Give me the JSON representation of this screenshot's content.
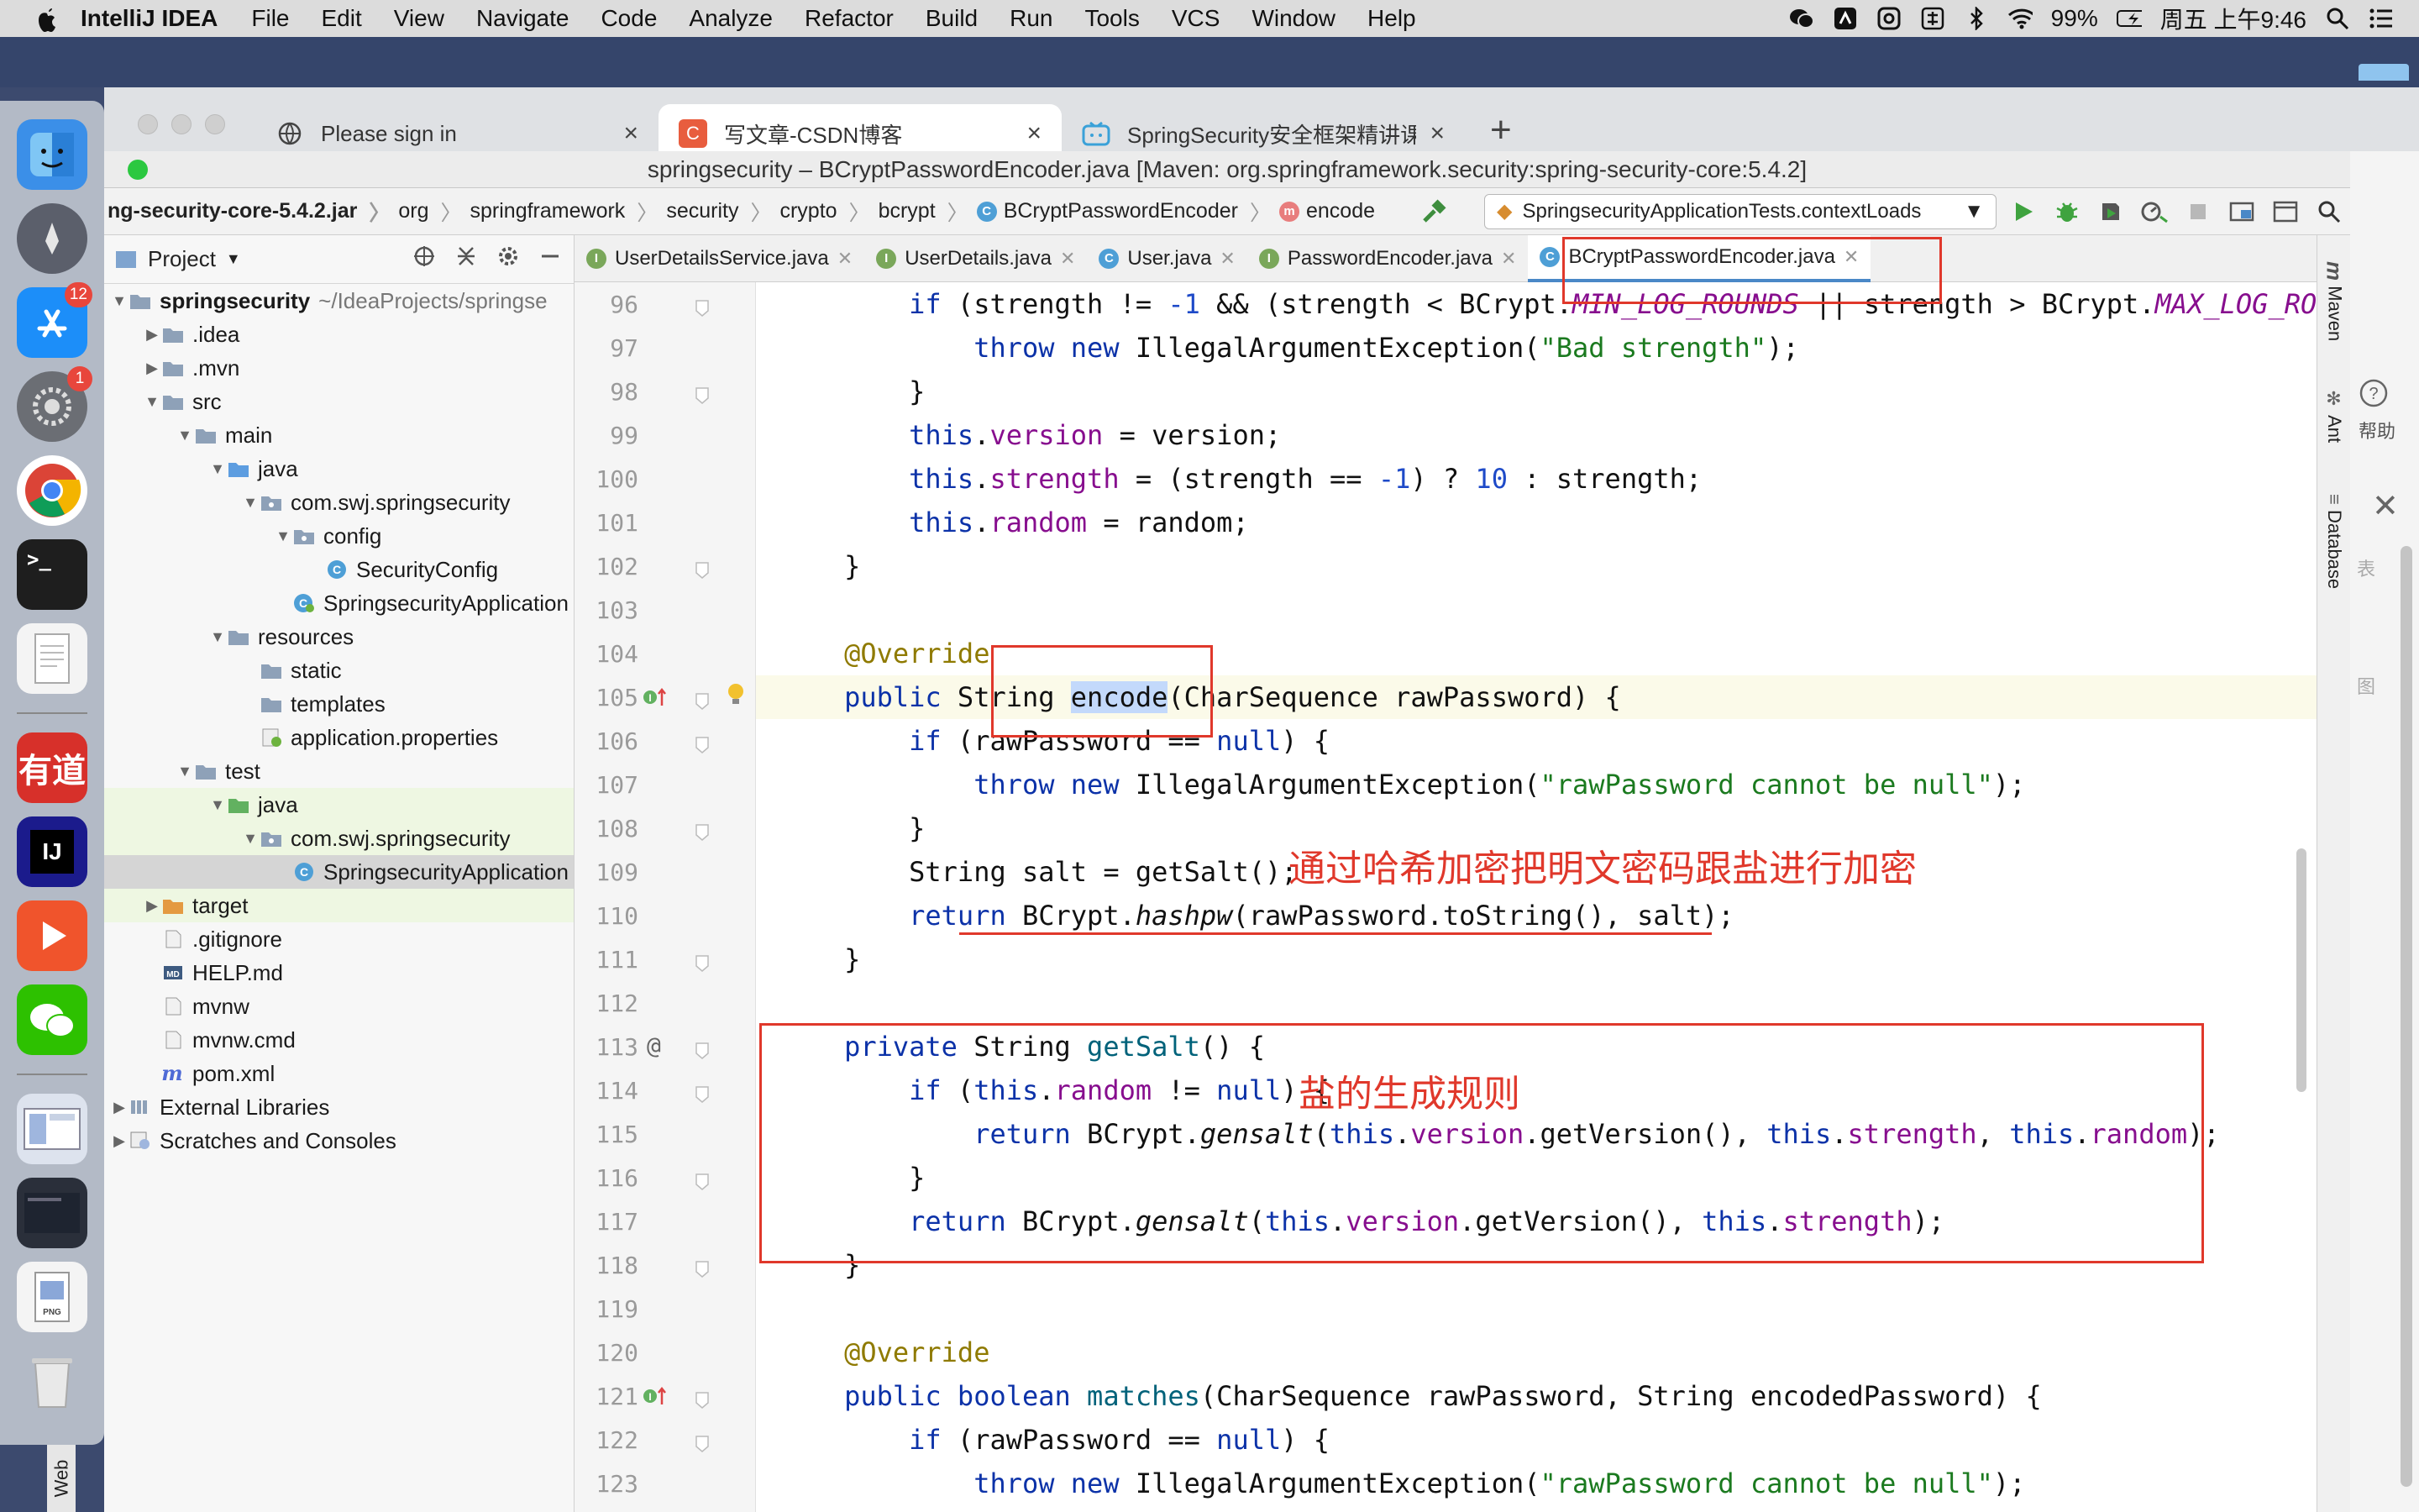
{
  "menubar": {
    "app_name": "IntelliJ IDEA",
    "items": [
      "File",
      "Edit",
      "View",
      "Navigate",
      "Code",
      "Analyze",
      "Refactor",
      "Build",
      "Run",
      "Tools",
      "VCS",
      "Window",
      "Help"
    ],
    "battery": "99%",
    "clock": "周五 上午9:46"
  },
  "dock": {
    "badges": {
      "appstore": "12",
      "settings": "1"
    },
    "web_tab": "Web"
  },
  "browser": {
    "tabs": [
      {
        "title": "Please sign in",
        "favicon": "globe-icon"
      },
      {
        "title": "写文章-CSDN博客",
        "favicon": "csdn-icon",
        "letter": "C"
      },
      {
        "title": "SpringSecurity安全框架精讲课",
        "favicon": "bilibili-icon"
      }
    ],
    "new_tab": "+",
    "close": "×"
  },
  "ide": {
    "window_title": "springsecurity – BCryptPasswordEncoder.java [Maven: org.springframework.security:spring-security-core:5.4.2]",
    "breadcrumbs": [
      "ng-security-core-5.4.2.jar",
      "org",
      "springframework",
      "security",
      "crypto",
      "bcrypt",
      "BCryptPasswordEncoder",
      "encode"
    ],
    "run_config": "SpringsecurityApplicationTests.contextLoads",
    "project_label": "Project",
    "tree": [
      {
        "depth": 0,
        "label": "springsecurity",
        "path": "~/IdeaProjects/springse",
        "type": "module",
        "open": true,
        "bold": true
      },
      {
        "depth": 1,
        "label": ".idea",
        "type": "folder",
        "open": false
      },
      {
        "depth": 1,
        "label": ".mvn",
        "type": "folder",
        "open": false
      },
      {
        "depth": 1,
        "label": "src",
        "type": "folder",
        "open": true
      },
      {
        "depth": 2,
        "label": "main",
        "type": "folder",
        "open": true
      },
      {
        "depth": 3,
        "label": "java",
        "type": "srcfolder",
        "open": true
      },
      {
        "depth": 4,
        "label": "com.swj.springsecurity",
        "type": "package",
        "open": true
      },
      {
        "depth": 5,
        "label": "config",
        "type": "package",
        "open": true
      },
      {
        "depth": 6,
        "label": "SecurityConfig",
        "type": "class"
      },
      {
        "depth": 5,
        "label": "SpringsecurityApplication",
        "type": "springclass"
      },
      {
        "depth": 3,
        "label": "resources",
        "type": "resfolder",
        "open": true
      },
      {
        "depth": 4,
        "label": "static",
        "type": "folder"
      },
      {
        "depth": 4,
        "label": "templates",
        "type": "folder"
      },
      {
        "depth": 4,
        "label": "application.properties",
        "type": "props"
      },
      {
        "depth": 2,
        "label": "test",
        "type": "folder",
        "open": true
      },
      {
        "depth": 3,
        "label": "java",
        "type": "testfolder",
        "open": true,
        "hl": true
      },
      {
        "depth": 4,
        "label": "com.swj.springsecurity",
        "type": "package",
        "open": true,
        "hl": true
      },
      {
        "depth": 5,
        "label": "SpringsecurityApplication",
        "type": "class",
        "sel": true
      },
      {
        "depth": 1,
        "label": "target",
        "type": "orangefolder",
        "open": false,
        "hl": true
      },
      {
        "depth": 1,
        "label": ".gitignore",
        "type": "file"
      },
      {
        "depth": 1,
        "label": "HELP.md",
        "type": "md"
      },
      {
        "depth": 1,
        "label": "mvnw",
        "type": "file"
      },
      {
        "depth": 1,
        "label": "mvnw.cmd",
        "type": "file"
      },
      {
        "depth": 1,
        "label": "pom.xml",
        "type": "maven"
      },
      {
        "depth": 0,
        "label": "External Libraries",
        "type": "libs",
        "open": false
      },
      {
        "depth": 0,
        "label": "Scratches and Consoles",
        "type": "scratch",
        "open": false
      }
    ],
    "editor_tabs": [
      {
        "label": "UserDetailsService.java",
        "kind": "interface"
      },
      {
        "label": "UserDetails.java",
        "kind": "interface"
      },
      {
        "label": "User.java",
        "kind": "class"
      },
      {
        "label": "PasswordEncoder.java",
        "kind": "interface"
      },
      {
        "label": "BCryptPasswordEncoder.java",
        "kind": "class",
        "active": true
      }
    ],
    "line_numbers": [
      "96",
      "97",
      "98",
      "99",
      "100",
      "101",
      "102",
      "103",
      "104",
      "105",
      "106",
      "107",
      "108",
      "109",
      "110",
      "111",
      "112",
      "113",
      "114",
      "115",
      "116",
      "117",
      "118",
      "119",
      "120",
      "121",
      "122",
      "123"
    ],
    "code_lines": [
      [
        [
          "        ",
          ""
        ],
        [
          "if",
          "kw"
        ],
        [
          " (strength != ",
          ""
        ],
        [
          "-1",
          "numc"
        ],
        [
          " && (strength < BCrypt.",
          ""
        ],
        [
          "MIN_LOG_ROUNDS",
          "sfld"
        ],
        [
          " || strength > BCrypt.",
          ""
        ],
        [
          "MAX_LOG_ROUNDS",
          "sfld"
        ],
        [
          "))",
          ""
        ]
      ],
      [
        [
          "            ",
          ""
        ],
        [
          "throw new",
          "kw"
        ],
        [
          " IllegalArgumentException(",
          ""
        ],
        [
          "\"Bad strength\"",
          "str"
        ],
        [
          ");",
          ""
        ]
      ],
      [
        [
          "        }",
          ""
        ]
      ],
      [
        [
          "        ",
          ""
        ],
        [
          "this",
          "kw"
        ],
        [
          ".",
          ""
        ],
        [
          "version",
          "fld"
        ],
        [
          " = version;",
          ""
        ]
      ],
      [
        [
          "        ",
          ""
        ],
        [
          "this",
          "kw"
        ],
        [
          ".",
          ""
        ],
        [
          "strength",
          "fld"
        ],
        [
          " = (strength == ",
          ""
        ],
        [
          "-1",
          "numc"
        ],
        [
          ") ? ",
          ""
        ],
        [
          "10",
          "numc"
        ],
        [
          " : strength;",
          ""
        ]
      ],
      [
        [
          "        ",
          ""
        ],
        [
          "this",
          "kw"
        ],
        [
          ".",
          ""
        ],
        [
          "random",
          "fld"
        ],
        [
          " = random;",
          ""
        ]
      ],
      [
        [
          "    }",
          ""
        ]
      ],
      [
        [
          "",
          ""
        ]
      ],
      [
        [
          "    ",
          ""
        ],
        [
          "@Override",
          "ann"
        ]
      ],
      [
        [
          "    ",
          ""
        ],
        [
          "public",
          "kw"
        ],
        [
          " String ",
          ""
        ],
        [
          "encode",
          "selw"
        ],
        [
          "(CharSequence rawPassword) {",
          ""
        ]
      ],
      [
        [
          "        ",
          ""
        ],
        [
          "if",
          "kw"
        ],
        [
          " (rawPassword == ",
          ""
        ],
        [
          "null",
          "kw"
        ],
        [
          ") {",
          ""
        ]
      ],
      [
        [
          "            ",
          ""
        ],
        [
          "throw new",
          "kw"
        ],
        [
          " IllegalArgumentException(",
          ""
        ],
        [
          "\"rawPassword cannot be null\"",
          "str"
        ],
        [
          ");",
          ""
        ]
      ],
      [
        [
          "        }",
          ""
        ]
      ],
      [
        [
          "        String salt = getSalt();",
          ""
        ]
      ],
      [
        [
          "        ",
          ""
        ],
        [
          "return",
          "kw"
        ],
        [
          " BCrypt.",
          ""
        ],
        [
          "hashpw",
          "sfn"
        ],
        [
          "(rawPassword.toString(), salt);",
          ""
        ]
      ],
      [
        [
          "    }",
          ""
        ]
      ],
      [
        [
          "",
          ""
        ]
      ],
      [
        [
          "    ",
          ""
        ],
        [
          "private",
          "kw"
        ],
        [
          " String ",
          ""
        ],
        [
          "getSalt",
          "fnd"
        ],
        [
          "() {",
          ""
        ]
      ],
      [
        [
          "        ",
          ""
        ],
        [
          "if",
          "kw"
        ],
        [
          " (",
          ""
        ],
        [
          "this",
          "kw"
        ],
        [
          ".",
          ""
        ],
        [
          "random",
          "fld"
        ],
        [
          " != ",
          ""
        ],
        [
          "null",
          "kw"
        ],
        [
          ") {",
          ""
        ]
      ],
      [
        [
          "            ",
          ""
        ],
        [
          "return",
          "kw"
        ],
        [
          " BCrypt.",
          ""
        ],
        [
          "gensalt",
          "sfn"
        ],
        [
          "(",
          ""
        ],
        [
          "this",
          "kw"
        ],
        [
          ".",
          ""
        ],
        [
          "version",
          "fld"
        ],
        [
          ".getVersion(), ",
          ""
        ],
        [
          "this",
          "kw"
        ],
        [
          ".",
          ""
        ],
        [
          "strength",
          "fld"
        ],
        [
          ", ",
          ""
        ],
        [
          "this",
          "kw"
        ],
        [
          ".",
          ""
        ],
        [
          "random",
          "fld"
        ],
        [
          ");",
          ""
        ]
      ],
      [
        [
          "        }",
          ""
        ]
      ],
      [
        [
          "        ",
          ""
        ],
        [
          "return",
          "kw"
        ],
        [
          " BCrypt.",
          ""
        ],
        [
          "gensalt",
          "sfn"
        ],
        [
          "(",
          ""
        ],
        [
          "this",
          "kw"
        ],
        [
          ".",
          ""
        ],
        [
          "version",
          "fld"
        ],
        [
          ".getVersion(), ",
          ""
        ],
        [
          "this",
          "kw"
        ],
        [
          ".",
          ""
        ],
        [
          "strength",
          "fld"
        ],
        [
          ");",
          ""
        ]
      ],
      [
        [
          "    }",
          ""
        ]
      ],
      [
        [
          "",
          ""
        ]
      ],
      [
        [
          "    ",
          ""
        ],
        [
          "@Override",
          "ann"
        ]
      ],
      [
        [
          "    ",
          ""
        ],
        [
          "public boolean",
          "kw"
        ],
        [
          " ",
          ""
        ],
        [
          "matches",
          "fnd"
        ],
        [
          "(CharSequence rawPassword, String encodedPassword) {",
          ""
        ]
      ],
      [
        [
          "        ",
          ""
        ],
        [
          "if",
          "kw"
        ],
        [
          " (rawPassword == ",
          ""
        ],
        [
          "null",
          "kw"
        ],
        [
          ") {",
          ""
        ]
      ],
      [
        [
          "            ",
          ""
        ],
        [
          "throw new",
          "kw"
        ],
        [
          " IllegalArgumentException(",
          ""
        ],
        [
          "\"rawPassword cannot be null\"",
          "str"
        ],
        [
          ");",
          ""
        ]
      ]
    ],
    "right_tool_windows": [
      "Maven",
      "Ant",
      "Database"
    ],
    "annotations": {
      "encode_note": "通过哈希加密把明文密码跟盐进行加密",
      "salt_note": "盐的生成规则"
    },
    "behind_window_text": {
      "help": "帮助",
      "a": "表",
      "b": "图"
    }
  },
  "colors": {
    "accent": "#4a88c7",
    "annotation": "#e0382b",
    "keyword": "#0c32a8",
    "string": "#1b7a1f",
    "field": "#870e8e"
  }
}
